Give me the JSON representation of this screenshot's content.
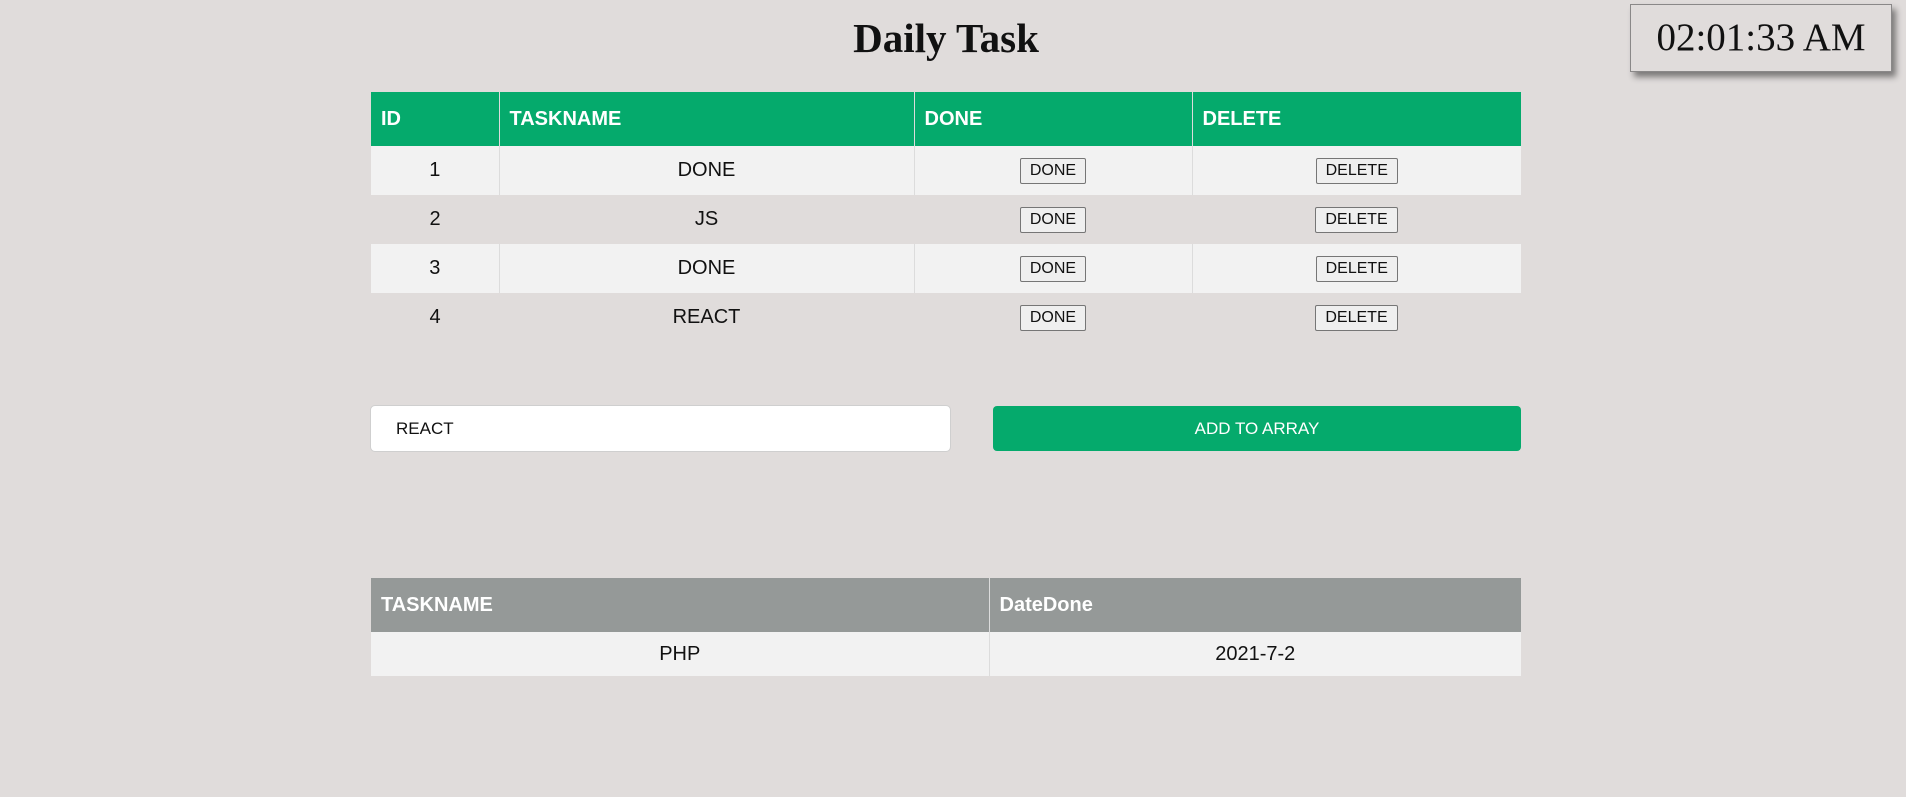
{
  "page": {
    "title": "Daily Task"
  },
  "clock": {
    "time": "02:01:33 AM"
  },
  "task_table": {
    "headers": [
      "ID",
      "TASKNAME",
      "DONE",
      "DELETE"
    ],
    "rows": [
      {
        "id": "1",
        "taskname": "DONE",
        "done_label": "DONE",
        "delete_label": "DELETE"
      },
      {
        "id": "2",
        "taskname": "JS",
        "done_label": "DONE",
        "delete_label": "DELETE"
      },
      {
        "id": "3",
        "taskname": "DONE",
        "done_label": "DONE",
        "delete_label": "DELETE"
      },
      {
        "id": "4",
        "taskname": "REACT",
        "done_label": "DONE",
        "delete_label": "DELETE"
      }
    ]
  },
  "form": {
    "input_value": "REACT",
    "add_label": "ADD TO ARRAY"
  },
  "done_table": {
    "headers": [
      "TASKNAME",
      "DateDone"
    ],
    "rows": [
      {
        "taskname": "PHP",
        "date_done": "2021-7-2"
      }
    ]
  },
  "colors": {
    "accent": "#05aa6c",
    "done_header": "#959998",
    "background": "#e0dcdb"
  }
}
